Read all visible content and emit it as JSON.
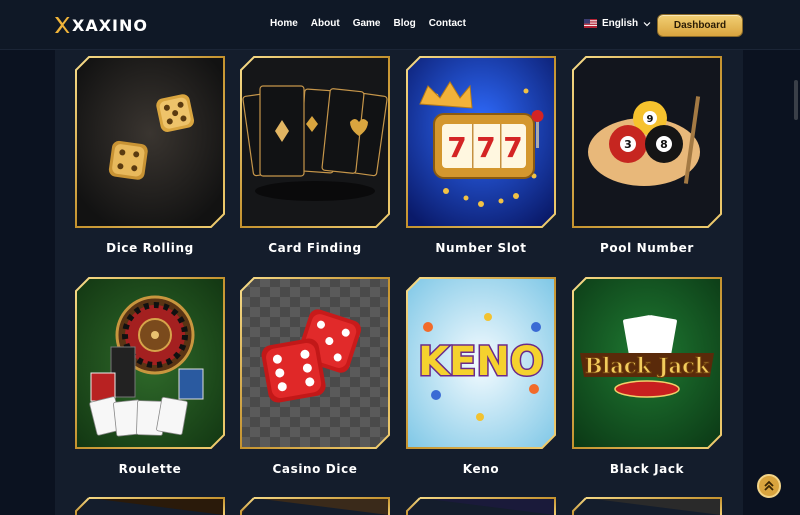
{
  "brand": {
    "name_main": "XAXINO"
  },
  "nav": {
    "items": [
      "Home",
      "About",
      "Game",
      "Blog",
      "Contact"
    ]
  },
  "language": {
    "label": "English"
  },
  "header": {
    "dashboard_label": "Dashboard"
  },
  "games": [
    {
      "label": "Dice Rolling",
      "icon": "gold-dice-image"
    },
    {
      "label": "Card Finding",
      "icon": "playing-cards-image"
    },
    {
      "label": "Number Slot",
      "icon": "slot-machine-777-image"
    },
    {
      "label": "Pool Number",
      "icon": "billiard-balls-image"
    },
    {
      "label": "Roulette",
      "icon": "roulette-wheel-image"
    },
    {
      "label": "Casino Dice",
      "icon": "red-dice-image"
    },
    {
      "label": "Keno",
      "icon": "keno-logo-image",
      "logo_text": "KENO"
    },
    {
      "label": "Black Jack",
      "icon": "blackjack-logo-image",
      "logo_text": "Black Jack"
    }
  ],
  "colors": {
    "gold": "#d9a43e",
    "background": "#0b1220",
    "card_bg": "#141d2c"
  }
}
